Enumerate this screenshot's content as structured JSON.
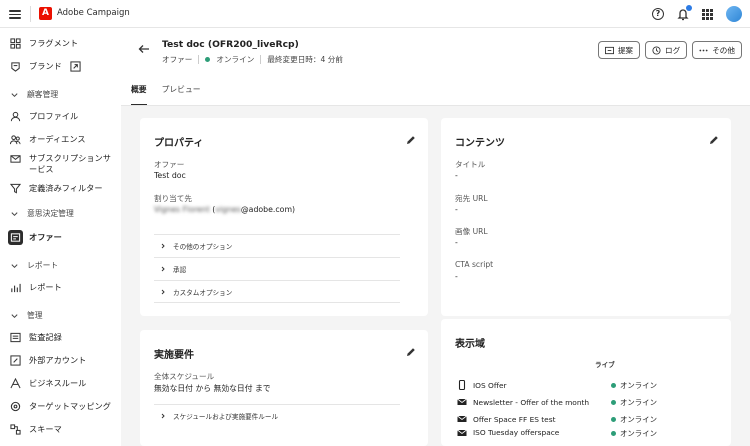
{
  "topbar": {
    "app_title": "Adobe Campaign",
    "logo_letter": "A"
  },
  "sidebar": {
    "items": [
      {
        "label": "フラグメント",
        "icon": "fragment-icon"
      },
      {
        "label": "ブランド",
        "icon": "brand-icon"
      },
      {
        "label": "顧客管理",
        "section": true
      },
      {
        "label": "プロファイル",
        "icon": "profile-icon"
      },
      {
        "label": "オーディエンス",
        "icon": "audience-icon"
      },
      {
        "label": "サブスクリプションサービス",
        "icon": "subscription-icon"
      },
      {
        "label": "定義済みフィルター",
        "icon": "filter-icon"
      },
      {
        "label": "意思決定管理",
        "section": true
      },
      {
        "label": "オファー",
        "icon": "offer-icon",
        "active": true
      },
      {
        "label": "レポート",
        "section": true
      },
      {
        "label": "レポート",
        "icon": "report-icon"
      },
      {
        "label": "管理",
        "section": true
      },
      {
        "label": "監査記録",
        "icon": "audit-icon"
      },
      {
        "label": "外部アカウント",
        "icon": "external-account-icon"
      },
      {
        "label": "ビジネスルール",
        "icon": "business-rule-icon"
      },
      {
        "label": "ターゲットマッピング",
        "icon": "target-mapping-icon"
      },
      {
        "label": "スキーマ",
        "icon": "schema-icon"
      }
    ],
    "subscription_line1": "サブスクリプションサ",
    "subscription_line2": "ービス"
  },
  "header": {
    "title": "Test doc (OFR200_liveRcp)",
    "type": "オファー",
    "status": "オンライン",
    "modified": "最終変更日時：4 分前",
    "buttons": {
      "propose": "提案",
      "log": "ログ",
      "more": "その他"
    },
    "tabs": [
      "概要",
      "プレビュー"
    ]
  },
  "properties": {
    "title": "プロパティ",
    "offer_label": "オファー",
    "offer_value": "Test doc",
    "assignee_label": "割り当て先",
    "assignee_name": "Vignes Florent",
    "assignee_email_user": "vignes",
    "assignee_email_domain": "@adobe.com)",
    "accordions": [
      "その他のオプション",
      "承認",
      "カスタムオプション"
    ]
  },
  "contents": {
    "title": "コンテンツ",
    "fields": [
      {
        "label": "タイトル",
        "value": "-"
      },
      {
        "label": "宛先 URL",
        "value": "-"
      },
      {
        "label": "画像 URL",
        "value": "-"
      },
      {
        "label": "CTA script",
        "value": "-"
      }
    ]
  },
  "eligibility": {
    "title": "実施要件",
    "schedule_label": "全体スケジュール",
    "schedule_value": "無効な日付 から 無効な日付 まで",
    "accordion": "スケジュールおよび実施要件ルール"
  },
  "surfaces": {
    "title": "表示域",
    "column_header": "ライブ",
    "rows": [
      {
        "name": "IOS Offer",
        "icon": "mobile-icon",
        "status": "オンライン"
      },
      {
        "name": "Newsletter - Offer of the month",
        "icon": "email-icon",
        "status": "オンライン"
      },
      {
        "name": "Offer Space FF ES test",
        "icon": "email-icon",
        "status": "オンライン"
      },
      {
        "name": "ISO Tuesday offerspace",
        "icon": "email-icon",
        "status": "オンライン"
      }
    ]
  },
  "colors": {
    "online": "#2d9d78",
    "adobe_red": "#eb1000",
    "notification": "#2c7be5"
  }
}
